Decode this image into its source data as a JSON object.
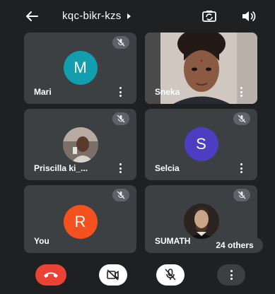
{
  "header": {
    "meeting_code": "kqc-bikr-kzs",
    "back_icon": "arrow-back-icon",
    "switch_camera_icon": "switch-camera-icon",
    "speaker_icon": "speaker-icon"
  },
  "participants": [
    {
      "name": "Mari",
      "initial": "M",
      "avatar_color": "#129eaf",
      "muted": true
    },
    {
      "name": "Sneka",
      "video": true,
      "muted": false
    },
    {
      "name": "Priscilla ki_...",
      "photo": true,
      "muted": true
    },
    {
      "name": "Selcia",
      "initial": "S",
      "avatar_color": "#4b3ec0",
      "muted": true
    },
    {
      "name": "You",
      "initial": "R",
      "avatar_color": "#f4511e",
      "muted": true
    },
    {
      "name": "SUMATH",
      "photo": true,
      "muted": true
    }
  ],
  "others_label": "24 others",
  "controls": {
    "end_call_icon": "end-call-icon",
    "camera_icon": "camera-off-icon",
    "mic_icon": "mic-off-icon",
    "more_icon": "more-vert-icon"
  },
  "colors": {
    "background": "#1f2022",
    "tile": "#3c4043",
    "end_call": "#ea4335"
  }
}
